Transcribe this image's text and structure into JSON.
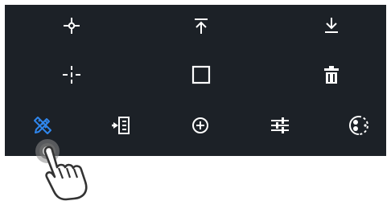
{
  "toolbar": {
    "row1": [
      {
        "name": "crosshair-point",
        "icon": "crosshair-point-icon"
      },
      {
        "name": "move-to-top",
        "icon": "arrow-up-to-line-icon"
      },
      {
        "name": "move-to-bottom",
        "icon": "arrow-down-to-line-icon"
      }
    ],
    "row2": [
      {
        "name": "crosshair-dashed",
        "icon": "dashed-crosshair-icon"
      },
      {
        "name": "rectangle",
        "icon": "square-outline-icon"
      },
      {
        "name": "delete",
        "icon": "trash-icon"
      }
    ],
    "row3": [
      {
        "name": "draw-tools",
        "icon": "pencil-ruler-icon",
        "active": true
      },
      {
        "name": "import",
        "icon": "import-icon"
      },
      {
        "name": "locate-target",
        "icon": "target-icon"
      },
      {
        "name": "adjust",
        "icon": "sliders-icon"
      },
      {
        "name": "dotted-circle",
        "icon": "dotted-circle-icon"
      }
    ]
  },
  "colors": {
    "panel_bg": "#1c2127",
    "icon": "#ffffff",
    "active_icon": "#2f86ec",
    "page_bg": "#ffffff"
  },
  "gesture": {
    "icon": "tap-hand-icon"
  }
}
